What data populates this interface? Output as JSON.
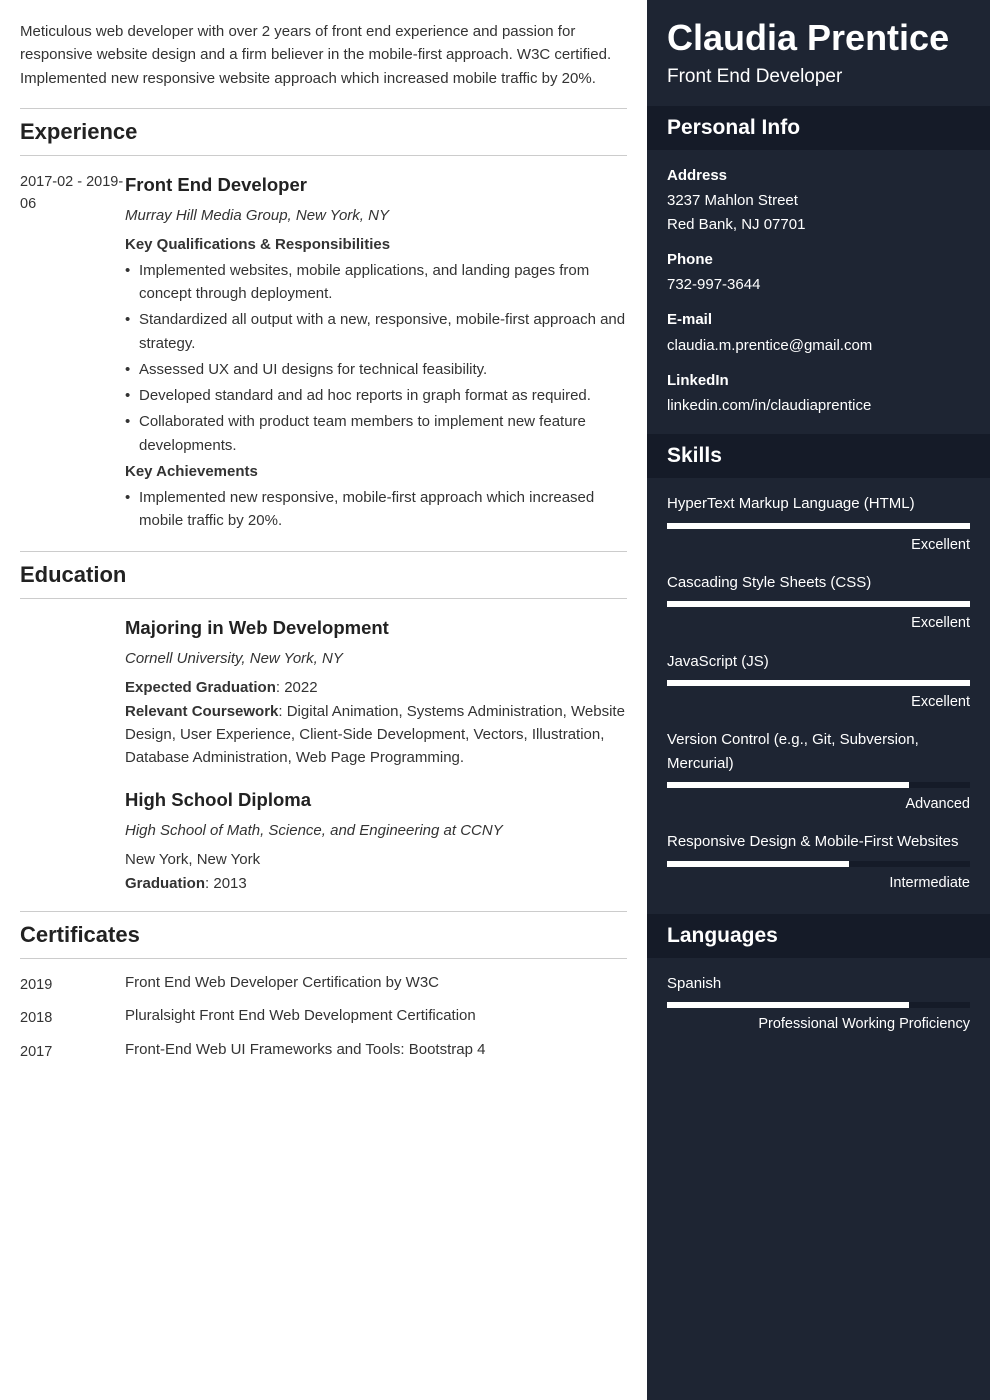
{
  "summary": "Meticulous web developer with over 2 years of front end experience and passion for responsive website design and a firm believer in the mobile-first approach. W3C certified. Implemented new responsive website approach which increased mobile traffic by 20%.",
  "sections": {
    "experience": "Experience",
    "education": "Education",
    "certificates": "Certificates"
  },
  "experience": [
    {
      "date": "2017-02 - 2019-06",
      "title": "Front End Developer",
      "org": "Murray Hill Media Group, New York, NY",
      "respHeader": "Key Qualifications & Responsibilities",
      "responsibilities": [
        "Implemented websites, mobile applications, and landing pages from concept through deployment.",
        "Standardized all output with a new, responsive, mobile-first approach and strategy.",
        "Assessed UX and UI designs for technical feasibility.",
        "Developed standard and ad hoc reports in graph format as required.",
        "Collaborated with product team members to implement new feature developments."
      ],
      "achHeader": "Key Achievements",
      "achievements": [
        "Implemented new responsive, mobile-first approach which increased mobile traffic by 20%."
      ]
    }
  ],
  "education": [
    {
      "title": "Majoring in Web Development",
      "org": "Cornell University, New York, NY",
      "gradLabel": "Expected Graduation",
      "gradValue": ": 2022",
      "courseLabel": "Relevant Coursework",
      "courseValue": ": Digital Animation, Systems Administration, Website Design, User Experience, Client-Side Development, Vectors, Illustration, Database Administration, Web Page Programming."
    },
    {
      "title": "High School Diploma",
      "org": "High School of Math, Science, and Engineering at CCNY",
      "location": "New York, New York",
      "gradLabel": "Graduation",
      "gradValue": ": 2013"
    }
  ],
  "certificates": [
    {
      "year": "2019",
      "name": "Front End Web Developer Certification by W3C"
    },
    {
      "year": "2018",
      "name": "Pluralsight Front End Web Development Certification"
    },
    {
      "year": "2017",
      "name": "Front-End Web UI Frameworks and Tools: Bootstrap 4"
    }
  ],
  "name": "Claudia Prentice",
  "jobTitle": "Front End Developer",
  "sideHeaders": {
    "personal": "Personal Info",
    "skills": "Skills",
    "languages": "Languages"
  },
  "personal": {
    "addressLabel": "Address",
    "addressLine1": "3237 Mahlon Street",
    "addressLine2": "Red Bank, NJ 07701",
    "phoneLabel": "Phone",
    "phone": "732-997-3644",
    "emailLabel": "E-mail",
    "email": "claudia.m.prentice@gmail.com",
    "linkedinLabel": "LinkedIn",
    "linkedin": "linkedin.com/in/claudiaprentice"
  },
  "skills": [
    {
      "name": "HyperText Markup Language (HTML)",
      "level": "Excellent",
      "pct": 100
    },
    {
      "name": "Cascading Style Sheets (CSS)",
      "level": "Excellent",
      "pct": 100
    },
    {
      "name": "JavaScript (JS)",
      "level": "Excellent",
      "pct": 100
    },
    {
      "name": "Version Control (e.g., Git, Subversion, Mercurial)",
      "level": "Advanced",
      "pct": 80
    },
    {
      "name": "Responsive Design & Mobile-First Websites",
      "level": "Intermediate",
      "pct": 60
    }
  ],
  "languages": [
    {
      "name": "Spanish",
      "level": "Professional Working Proficiency",
      "pct": 80
    }
  ]
}
